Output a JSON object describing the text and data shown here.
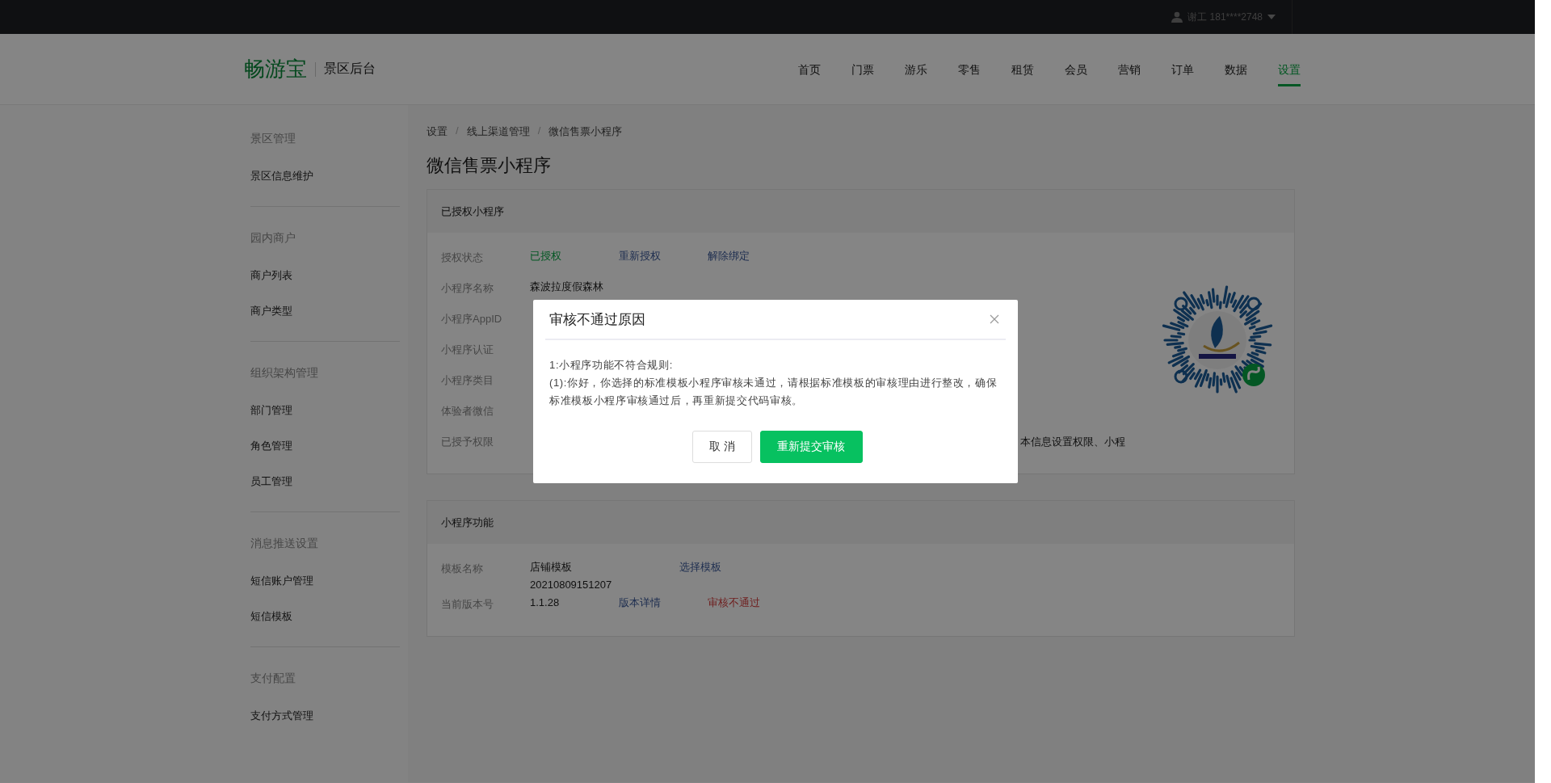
{
  "top_bar": {
    "user": "谢工 181****2748"
  },
  "header": {
    "logo": "畅游宝",
    "subtitle": "景区后台"
  },
  "nav": [
    {
      "label": "首页",
      "selected": false
    },
    {
      "label": "门票",
      "selected": false
    },
    {
      "label": "游乐",
      "selected": false
    },
    {
      "label": "零售",
      "selected": false
    },
    {
      "label": "租赁",
      "selected": false
    },
    {
      "label": "会员",
      "selected": false
    },
    {
      "label": "营销",
      "selected": false
    },
    {
      "label": "订单",
      "selected": false
    },
    {
      "label": "数据",
      "selected": false
    },
    {
      "label": "设置",
      "selected": true
    }
  ],
  "sidebar": {
    "groups": [
      {
        "heading": "景区管理",
        "items": [
          "景区信息维护"
        ]
      },
      {
        "heading": "园内商户",
        "items": [
          "商户列表",
          "商户类型"
        ]
      },
      {
        "heading": "组织架构管理",
        "items": [
          "部门管理",
          "角色管理",
          "员工管理"
        ]
      },
      {
        "heading": "消息推送设置",
        "items": [
          "短信账户管理",
          "短信模板"
        ]
      },
      {
        "heading": "支付配置",
        "items": [
          "支付方式管理"
        ]
      }
    ]
  },
  "breadcrumb": [
    "设置",
    "线上渠道管理",
    "微信售票小程序"
  ],
  "breadcrumb_separator": "/",
  "page_title": "微信售票小程序",
  "authorized_card": {
    "title": "已授权小程序",
    "rows": [
      {
        "label": "授权状态",
        "values": [
          {
            "kind": "status",
            "text": "已授权"
          },
          {
            "kind": "link",
            "text": "重新授权"
          },
          {
            "kind": "link",
            "text": "解除绑定"
          }
        ]
      },
      {
        "label": "小程序名称",
        "values": [
          {
            "kind": "text",
            "text": "森波拉度假森林"
          }
        ]
      },
      {
        "label": "小程序AppID"
      },
      {
        "label": "小程序认证"
      },
      {
        "label": "小程序类目"
      },
      {
        "label": "体验者微信"
      },
      {
        "label": "已授予权限",
        "values": [
          {
            "kind": "tail",
            "text": "本信息设置权限、小程"
          }
        ]
      }
    ]
  },
  "function_card": {
    "title": "小程序功能",
    "rows": [
      {
        "label": "模板名称",
        "values": [
          {
            "kind": "text",
            "text": "店铺模板\n20210809151207"
          },
          {
            "kind": "link",
            "text": "选择模板"
          }
        ]
      },
      {
        "label": "当前版本号",
        "values": [
          {
            "kind": "text",
            "text": "1.1.28"
          },
          {
            "kind": "link",
            "text": "版本详情"
          },
          {
            "kind": "error",
            "text": "审核不通过"
          }
        ]
      }
    ]
  },
  "dialog": {
    "title": "审核不通过原因",
    "paragraphs": [
      "1:小程序功能不符合规则:",
      "(1):你好，你选择的标准模板小程序审核未通过，请根据标准模板的审核理由进行整改，确保标准模板小程序审核通过后，再重新提交代码审核。"
    ],
    "buttons": [
      {
        "label": "取 消",
        "kind": "default"
      },
      {
        "label": "重新提交审核",
        "kind": "primary"
      }
    ]
  }
}
